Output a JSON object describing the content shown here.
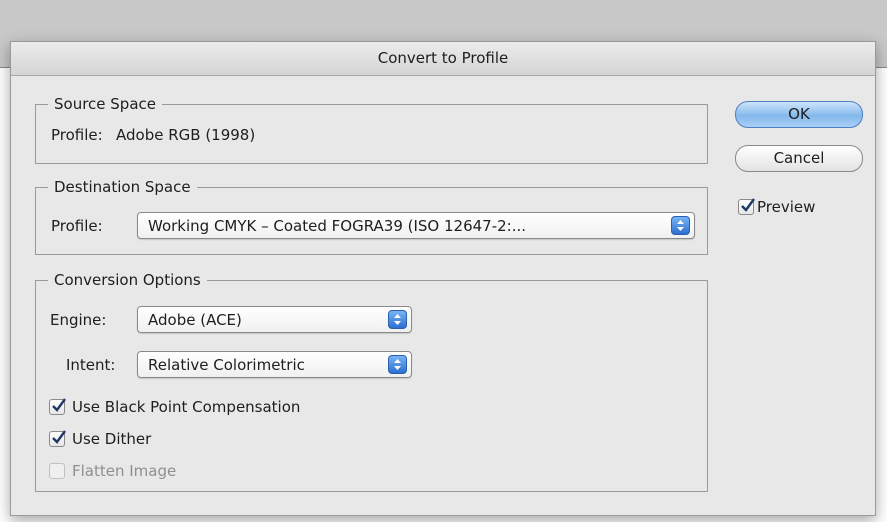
{
  "dialog": {
    "title": "Convert to Profile",
    "source_space": {
      "legend": "Source Space",
      "profile_label": "Profile:",
      "profile_value": "Adobe RGB (1998)"
    },
    "destination_space": {
      "legend": "Destination Space",
      "profile_label": "Profile:",
      "profile_selected": "Working CMYK – Coated FOGRA39 (ISO 12647-2:..."
    },
    "conversion_options": {
      "legend": "Conversion Options",
      "engine_label": "Engine:",
      "engine_selected": "Adobe (ACE)",
      "intent_label": "Intent:",
      "intent_selected": "Relative Colorimetric",
      "use_black_point": {
        "label": "Use Black Point Compensation",
        "checked": true
      },
      "use_dither": {
        "label": "Use Dither",
        "checked": true
      },
      "flatten_image": {
        "label": "Flatten Image",
        "checked": false,
        "enabled": false
      }
    },
    "buttons": {
      "ok_label": "OK",
      "cancel_label": "Cancel"
    },
    "preview": {
      "label": "Preview",
      "checked": true
    }
  },
  "icons": {
    "checkmark": "checkmark-icon",
    "stepper": "up-down-arrows-icon"
  },
  "colors": {
    "accent": "#3a7bd5",
    "dialog_bg": "#e8e8e8"
  }
}
